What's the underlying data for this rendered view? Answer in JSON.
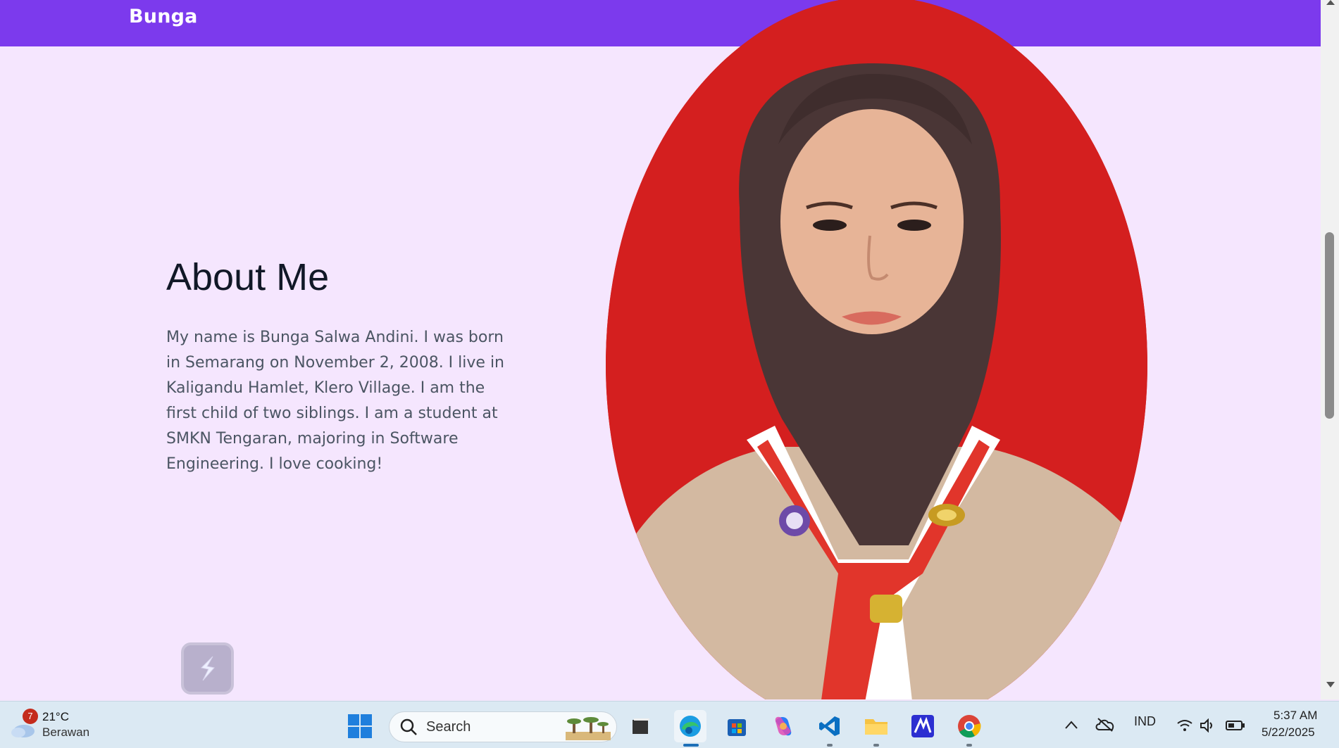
{
  "navbar": {
    "brand": "Bunga"
  },
  "about": {
    "title": "About Me",
    "text": "My name is Bunga Salwa Andini. I was born in Semarang on November 2, 2008. I live in Kaligandu Hamlet, Klero Village. I am the first child of two siblings. I am a student at SMKN Tengaran, majoring in Software Engineering. I love cooking!"
  },
  "photo": {
    "icon": "portrait-photo",
    "background_color": "#d41f1f"
  },
  "colors": {
    "navbar": "#7c3aed",
    "page_background": "#f5e6fe"
  },
  "taskbar": {
    "weather": {
      "badge": "7",
      "temp": "21°C",
      "desc": "Berawan"
    },
    "search": {
      "label": "Search"
    },
    "apps": [
      {
        "name": "file-explorer-dark",
        "icon": "task-view-icon"
      },
      {
        "name": "edge",
        "icon": "edge-icon"
      },
      {
        "name": "store",
        "icon": "store-icon"
      },
      {
        "name": "copilot",
        "icon": "copilot-icon"
      },
      {
        "name": "vscode",
        "icon": "vscode-icon"
      },
      {
        "name": "file-explorer",
        "icon": "folder-icon"
      },
      {
        "name": "app-m",
        "icon": "m-app-icon"
      },
      {
        "name": "chrome",
        "icon": "chrome-icon"
      }
    ],
    "tray": {
      "language": "IND"
    },
    "clock": {
      "time": "5:37 AM",
      "date": "5/22/2025"
    }
  }
}
